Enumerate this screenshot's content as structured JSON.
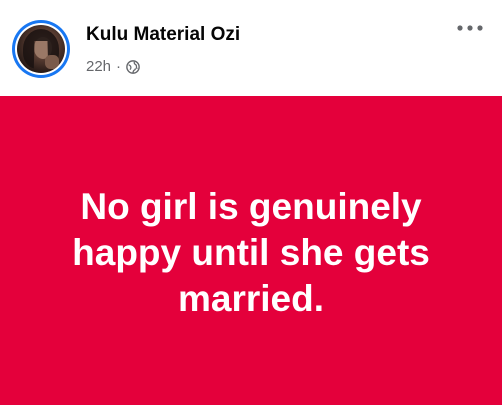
{
  "author": {
    "name": "Kulu Material Ozi",
    "avatar_icon": "profile-photo"
  },
  "meta": {
    "time": "22h",
    "separator": "·",
    "audience_icon": "globe-icon"
  },
  "menu": {
    "icon": "more-horizontal-icon"
  },
  "post": {
    "text": "No girl is genuinely happy until she gets married.",
    "background_color": "#e4003b",
    "text_color": "#ffffff"
  },
  "colors": {
    "avatar_ring": "#1877f2",
    "secondary_text": "#65676b"
  }
}
